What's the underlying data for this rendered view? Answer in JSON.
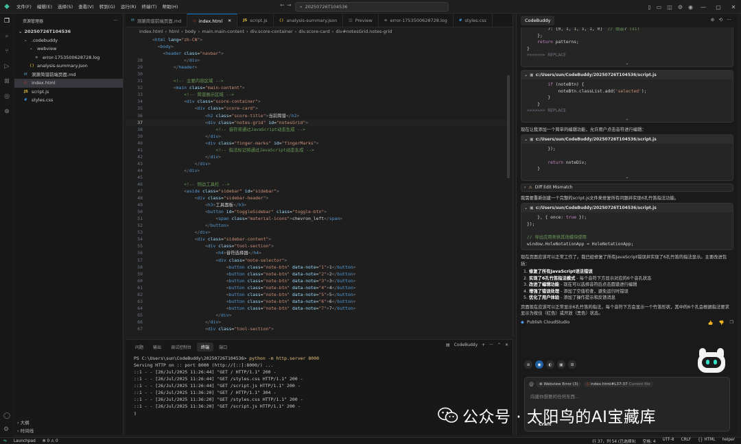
{
  "titlebar": {
    "menu": [
      "文件(F)",
      "编辑(E)",
      "选择(S)",
      "查看(V)",
      "转到(G)",
      "运行(R)",
      "终端(T)",
      "帮助(H)"
    ],
    "search": "20250726T104536"
  },
  "explorer": {
    "title": "资源管理器",
    "root": "20250726T104536",
    "items": [
      {
        "label": ".codebuddy",
        "indent": 1,
        "icon": "chevron-down-icon",
        "kind": "folder"
      },
      {
        "label": "webview",
        "indent": 2,
        "icon": "chevron-down-icon",
        "kind": "folder"
      },
      {
        "label": "error-1753500628728.log",
        "indent": 3,
        "icon": "log-file-icon",
        "kind": "log"
      },
      {
        "label": "analysis-summary.json",
        "indent": 2,
        "icon": "json-file-icon",
        "kind": "json"
      },
      {
        "label": "洞箫简谱前端页面.md",
        "indent": 1,
        "icon": "markdown-file-icon",
        "kind": "md"
      },
      {
        "label": "index.html",
        "indent": 1,
        "icon": "html-file-icon",
        "kind": "html",
        "active": true
      },
      {
        "label": "script.js",
        "indent": 1,
        "icon": "js-file-icon",
        "kind": "js"
      },
      {
        "label": "styles.css",
        "indent": 1,
        "icon": "css-file-icon",
        "kind": "css"
      }
    ],
    "footer": [
      "大纲",
      "时间线"
    ]
  },
  "editor": {
    "tabs": [
      {
        "label": "洞箫简谱前端页面.md",
        "kind": "md"
      },
      {
        "label": "index.html",
        "kind": "html",
        "active": true
      },
      {
        "label": "script.js",
        "kind": "js"
      },
      {
        "label": "analysis-summary.json",
        "kind": "json"
      },
      {
        "label": "Preview",
        "kind": "preview"
      },
      {
        "label": "error-1753500628728.log",
        "kind": "log"
      },
      {
        "label": "styles.css",
        "kind": "css"
      }
    ],
    "breadcrumb": [
      "index.html",
      "html",
      "body",
      "main.main-content",
      "div.score-container",
      "div.score-card",
      "div#notesGrid.notes-grid"
    ],
    "sticky": [
      "<html lang=\"zh-CN\">",
      "  <body>",
      "    <header class=\"navbar\">"
    ],
    "lines": [
      {
        "n": "28",
        "t": "            </div>"
      },
      {
        "n": "29",
        "t": "        </header>"
      },
      {
        "n": "30",
        "t": ""
      },
      {
        "n": "31",
        "t": "        <!-- 主要内容区域 -->"
      },
      {
        "n": "32",
        "t": "        <main class=\"main-content\">"
      },
      {
        "n": "33",
        "t": "            <!-- 简谱展示区域 -->"
      },
      {
        "n": "34",
        "t": "            <div class=\"score-container\">"
      },
      {
        "n": "35",
        "t": "                <div class=\"score-card\">"
      },
      {
        "n": "36",
        "t": "                    <h2 class=\"score-title\">当前简谱</h2>"
      },
      {
        "n": "37",
        "t": "                    <div class=\"notes-grid\" id=\"notesGrid\">",
        "cur": true
      },
      {
        "n": "38",
        "t": "                        <!-- 音符将通过JavaScript动态生成 -->"
      },
      {
        "n": "39",
        "t": "                    </div>"
      },
      {
        "n": "40",
        "t": "                    <div class=\"finger-marks\" id=\"fingerMarks\">"
      },
      {
        "n": "41",
        "t": "                        <!-- 指法标记将通过JavaScript动态生成 -->"
      },
      {
        "n": "42",
        "t": "                    </div>"
      },
      {
        "n": "43",
        "t": "                </div>"
      },
      {
        "n": "44",
        "t": "            </div>"
      },
      {
        "n": "45",
        "t": ""
      },
      {
        "n": "46",
        "t": "            <!-- 侧边工具栏 -->"
      },
      {
        "n": "47",
        "t": "            <aside class=\"sidebar\" id=\"sidebar\">"
      },
      {
        "n": "48",
        "t": "                <div class=\"sidebar-header\">"
      },
      {
        "n": "49",
        "t": "                    <h3>工具面板</h3>"
      },
      {
        "n": "50",
        "t": "                    <button id=\"toggleSidebar\" class=\"toggle-btn\">"
      },
      {
        "n": "51",
        "t": "                        <span class=\"material-icons\">chevron_left</span>"
      },
      {
        "n": "52",
        "t": "                    </button>"
      },
      {
        "n": "53",
        "t": "                </div>"
      },
      {
        "n": "54",
        "t": "                <div class=\"sidebar-content\">"
      },
      {
        "n": "55",
        "t": "                    <div class=\"tool-section\">"
      },
      {
        "n": "56",
        "t": "                        <h4>音符选择器</h4>"
      },
      {
        "n": "57",
        "t": "                        <div class=\"note-selector\">"
      },
      {
        "n": "58",
        "t": "                            <button class=\"note-btn\" data-note=\"1\">1</button>"
      },
      {
        "n": "59",
        "t": "                            <button class=\"note-btn\" data-note=\"2\">2</button>"
      },
      {
        "n": "60",
        "t": "                            <button class=\"note-btn\" data-note=\"3\">3</button>"
      },
      {
        "n": "61",
        "t": "                            <button class=\"note-btn\" data-note=\"4\">4</button>"
      },
      {
        "n": "62",
        "t": "                            <button class=\"note-btn\" data-note=\"5\">5</button>"
      },
      {
        "n": "63",
        "t": "                            <button class=\"note-btn\" data-note=\"6\">6</button>"
      },
      {
        "n": "64",
        "t": "                            <button class=\"note-btn\" data-note=\"7\">7</button>"
      },
      {
        "n": "65",
        "t": "                        </div>"
      },
      {
        "n": "66",
        "t": "                    </div>"
      },
      {
        "n": "67",
        "t": "                    <div class=\"tool-section\">"
      }
    ]
  },
  "terminal": {
    "tabs": [
      "问题",
      "输出",
      "调试控制台",
      "终端",
      "端口"
    ],
    "active_tab": "终端",
    "profile": "CodeBuddy",
    "lines": [
      {
        "prompt": "PS C:\\Users\\sun\\CodeBuddy\\20250726T104536> ",
        "cmd": "python -m http.server 8000"
      },
      {
        "text": "Serving HTTP on :: port 8000 (http://[::]:8000/) ..."
      },
      {
        "text": "::1 - - [26/Jul/2025 11:26:44] \"GET / HTTP/1.1\" 200 -"
      },
      {
        "text": "::1 - - [26/Jul/2025 11:26:44] \"GET /styles.css HTTP/1.1\" 200 -"
      },
      {
        "text": "::1 - - [26/Jul/2025 11:26:44] \"GET /script.js HTTP/1.1\" 200 -"
      },
      {
        "text": "::1 - - [26/Jul/2025 11:36:20] \"GET / HTTP/1.1\" 304 -"
      },
      {
        "text": "::1 - - [26/Jul/2025 11:36:20] \"GET /styles.css HTTP/1.1\" 200 -"
      },
      {
        "text": "::1 - - [26/Jul/2025 11:36:20] \"GET /script.js HTTP/1.1\" 200 -"
      }
    ]
  },
  "chat": {
    "tab": "CodeBuddy",
    "block1_lines": [
      "        7: [0, 1, 1, 1, 1, 0]  // 筒音7 (si)",
      "    };",
      "    return patterns;",
      "}",
      ">>>>>>> REPLACE"
    ],
    "path": "c:/Users/sun/CodeBuddy/20250726T104536/script.js",
    "block2_lines": [
      "        if (noteBtn) {",
      "            noteBtn.classList.add('selected');",
      "        }",
      "    }",
      ">>>>>>> REPLACE"
    ],
    "msg1": "现在让我添加一个简单的编辑功能，允许用户点击音符进行编辑：",
    "block3_lines": [
      "        });",
      "",
      "        return noteDiv;",
      "    }"
    ],
    "diff_label": "Diff Edit Mismatch",
    "msg2": "我需要重新创建一个完整的script.js文件来修复所有问题并实现6孔竹笛指法功能。",
    "block4_lines": [
      "    }, { once: true });",
      "});",
      "",
      "// 导出应用类供其他模块使用",
      "window.HoleNotationApp = HoleNotationApp;"
    ],
    "msg3": "现在页面应该可以正常工作了。我已经修复了所有JavaScript错误并实现了6孔竹笛的指法显示。主要改进包括：",
    "list": [
      {
        "b": "修复了所有JavaScript语法错误",
        "t": ""
      },
      {
        "b": "实现了6孔竹笛指法模式",
        "t": " - 每个音符下方显示对应的6个音孔状态"
      },
      {
        "b": "改进了编辑功能",
        "t": " - 现在可以选择音符后点击圆谱进行编辑"
      },
      {
        "b": "增强了错误处理",
        "t": " - 添加了空值检查，避免运行时错误"
      },
      {
        "b": "优化了用户体验",
        "t": " - 添加了操作提示和反馈消息"
      }
    ],
    "msg4": "页面现在应该可以正常显示6孔竹笛的指法，每个音符下方会显示一个竹笛形状，其中的6个孔会根据指法要求显示为按住（红色）或开放（黑色）状态。",
    "publish": "Publish CloudStudio",
    "ctx_chips": [
      "Webview Error (3)",
      "index.html#L37-37",
      "Current file"
    ],
    "placeholder": "向建你想要的任何东西...",
    "mode": "Craft"
  },
  "statusbar": {
    "left": [
      "Launchpad",
      "⊗ 0 ⚠ 0"
    ],
    "right": [
      "行 37，列 54 (已选择9)",
      "空格: 4",
      "UTF-8",
      "CRLF",
      "{} HTML",
      "helper"
    ]
  },
  "watermark": {
    "text": "公众号 · 太阳鸟的AI宝藏库"
  }
}
